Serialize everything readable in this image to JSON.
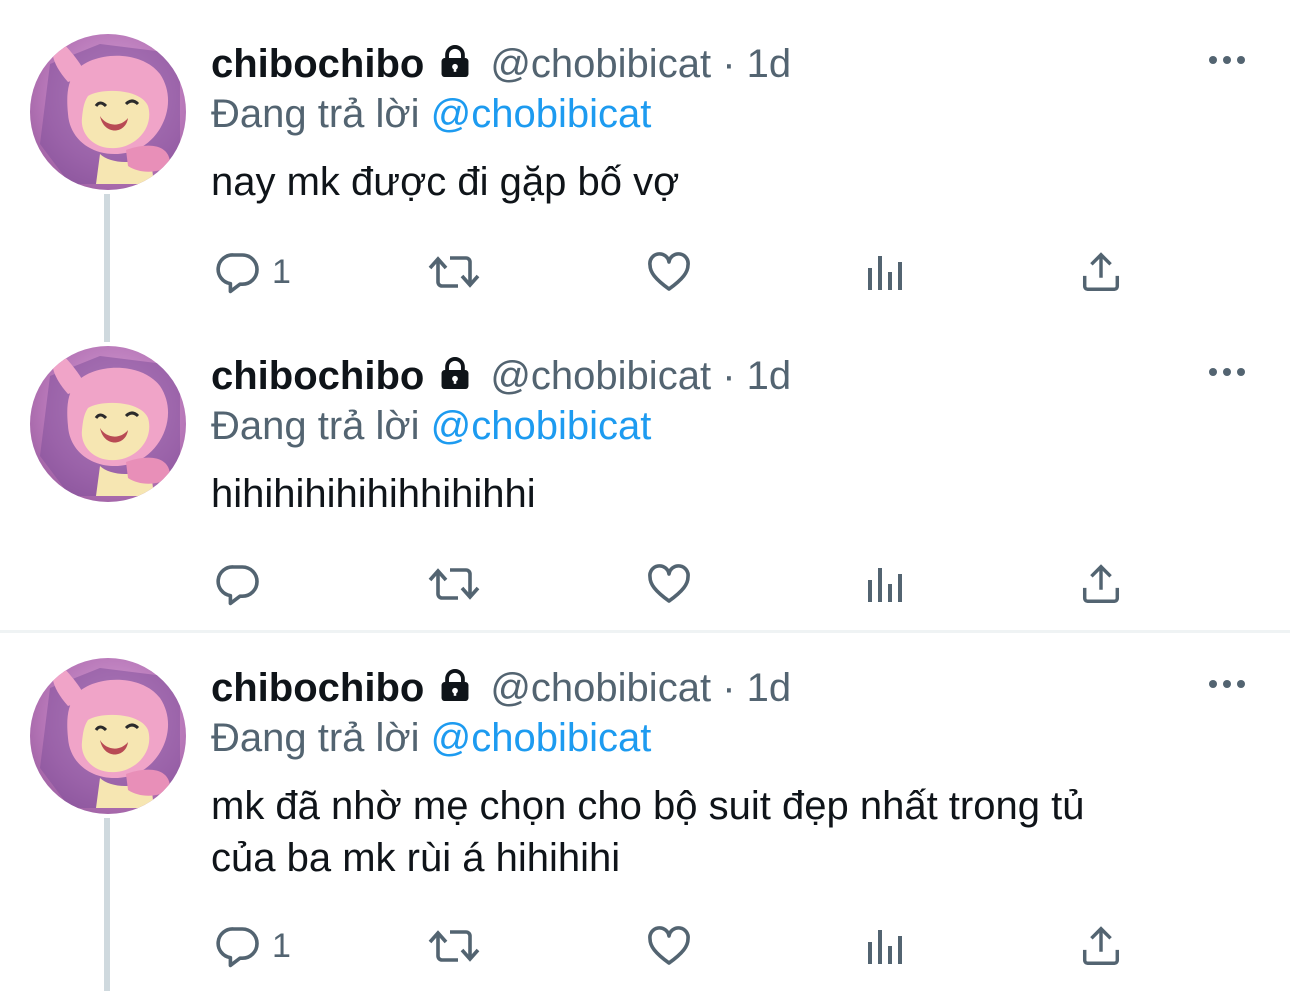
{
  "tweets": [
    {
      "display_name": "chibochibo",
      "handle": "@chobibicat",
      "separator": "·",
      "time": "1d",
      "replying_label": "Đang trả lời",
      "replying_to": "@chobibicat",
      "text": "nay mk được đi gặp bố vợ",
      "reply_count": "1"
    },
    {
      "display_name": "chibochibo",
      "handle": "@chobibicat",
      "separator": "·",
      "time": "1d",
      "replying_label": "Đang trả lời",
      "replying_to": "@chobibicat",
      "text": "hihihihihihihhihihhi",
      "reply_count": ""
    },
    {
      "display_name": "chibochibo",
      "handle": "@chobibicat",
      "separator": "·",
      "time": "1d",
      "replying_label": "Đang trả lời",
      "replying_to": "@chobibicat",
      "text_line1": "mk đã nhờ mẹ chọn cho bộ suit đẹp nhất trong tủ",
      "text_line2": "của ba mk rùi á hihihihi",
      "reply_count": "1"
    }
  ],
  "icons": {
    "protected": "lock-icon",
    "more": "more-horizontal-icon",
    "reply": "reply-icon",
    "retweet": "retweet-icon",
    "like": "heart-icon",
    "analytics": "analytics-icon",
    "share": "share-icon"
  },
  "colors": {
    "text_primary": "#0f1419",
    "text_secondary": "#536471",
    "link": "#1d9bf0",
    "thread_line": "#cfd9de",
    "divider": "#eff3f4"
  }
}
